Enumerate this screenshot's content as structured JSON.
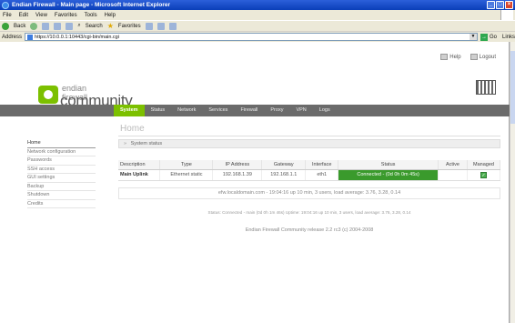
{
  "window": {
    "title": "Endian Firewall - Main page - Microsoft Internet Explorer"
  },
  "menubar": [
    "File",
    "Edit",
    "View",
    "Favorites",
    "Tools",
    "Help"
  ],
  "toolbar": {
    "back": "Back",
    "search": "Search",
    "favorites": "Favorites"
  },
  "address": {
    "label": "Address",
    "url": "https://10.0.0.1:10443/cgi-bin/main.cgi",
    "go": "Go",
    "links": "Links"
  },
  "header": {
    "help": "Help",
    "logout": "Logout",
    "logo_line1": "endian firewall",
    "logo_line2": "community"
  },
  "nav": [
    "System",
    "Status",
    "Network",
    "Services",
    "Firewall",
    "Proxy",
    "VPN",
    "Logs"
  ],
  "page_title": "Home",
  "sidebar": [
    "Home",
    "Network configuration",
    "Passwords",
    "SSH access",
    "GUI settings",
    "Backup",
    "Shutdown",
    "Credits"
  ],
  "section": {
    "title": "System status"
  },
  "table": {
    "headers": [
      "Description",
      "Type",
      "IP Address",
      "Gateway",
      "Interface",
      "Status",
      "Active",
      "Managed"
    ],
    "rows": [
      [
        "Main Uplink",
        "Ethernet static",
        "192.168.1.39",
        "192.168.1.1",
        "eth1",
        "Connected - (0d 0h 0m 45s)",
        "",
        ""
      ]
    ]
  },
  "uptime": "efw.localdomain.com - 19:04:16 up 10 min, 3 users, load average: 3.76, 3.28, 0.14",
  "statusline": "Status: Connected - main (0d 0h 1m 46s) Uptime: 19:04:16 up 10 min, 3 users, load average: 3.76, 3.28, 0.14",
  "footer": "Endian Firewall Community release 2.2 rc3 (c) 2004-2008",
  "colors": {
    "nav_bg": "#6b6b6b",
    "accent": "#7cc000",
    "status_ok": "#3a9a2c"
  }
}
